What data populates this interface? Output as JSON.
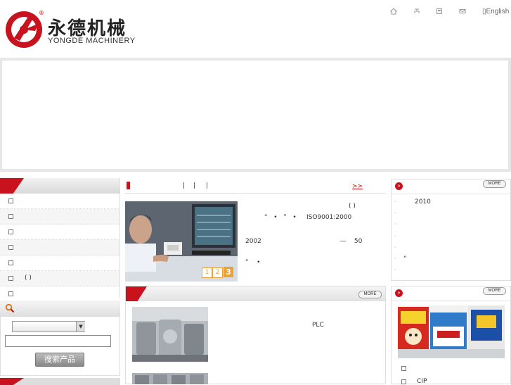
{
  "header": {
    "logo_registered": "®",
    "logo_cn": "永德机械",
    "logo_en": "YONGDE MACHINERY",
    "icons": [
      "home-icon",
      "sitemap-icon",
      "bookmark-icon",
      "mail-icon"
    ],
    "language_label": "English"
  },
  "left": {
    "menu_items": [
      "",
      "",
      "",
      "",
      "",
      "( )",
      ""
    ],
    "search_button": "搜索产品"
  },
  "middle": {
    "tabs": [
      "|",
      "|",
      "|"
    ],
    "more_link": ">>",
    "slides": [
      "1",
      "2",
      "3"
    ],
    "intro_lines": [
      "( )",
      "“   •   ”   •     ISO9001:2000",
      "2002                                       —    50",
      "“    •"
    ],
    "products_more": "MORE",
    "product_text": "PLC"
  },
  "right": {
    "news_more": "MORE",
    "news_items": [
      "2010",
      "",
      "",
      "",
      "",
      "“",
      ""
    ],
    "images_more": "MORE",
    "image_items": [
      "",
      "CIP"
    ]
  },
  "colors": {
    "brand_red": "#c8121d",
    "accent_orange": "#e7a23a"
  }
}
